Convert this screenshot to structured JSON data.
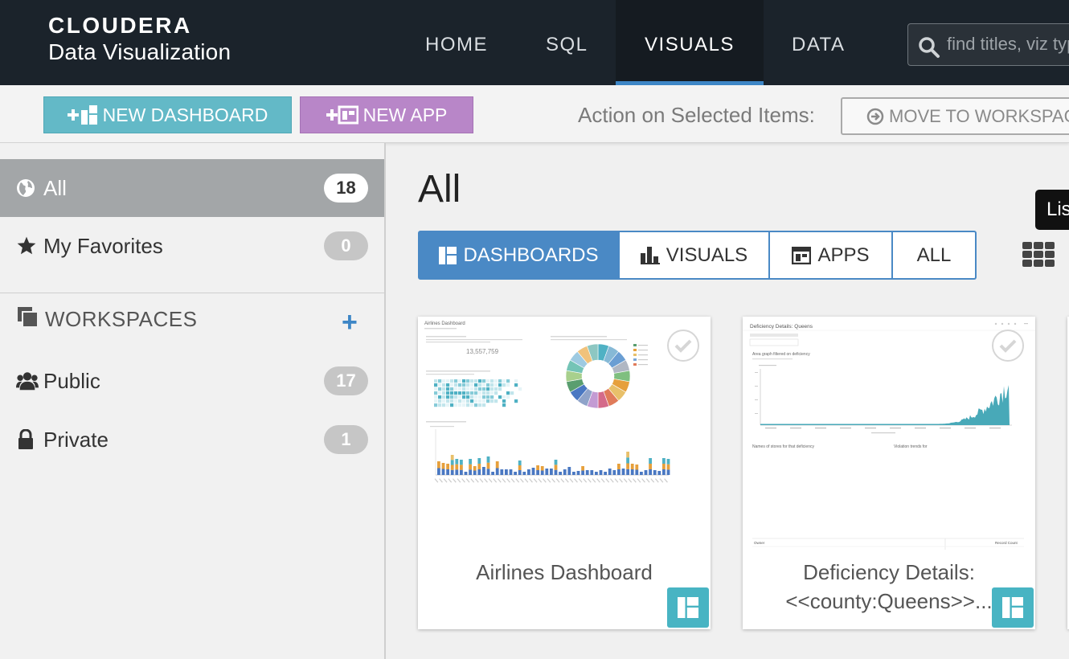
{
  "brand": {
    "logo_text": "CLOUDERA",
    "product": "Data Visualization"
  },
  "nav": {
    "home": "HOME",
    "sql": "SQL",
    "visuals": "VISUALS",
    "data": "DATA"
  },
  "search": {
    "placeholder": "find titles, viz types, tables..."
  },
  "actions": {
    "new_dashboard": "NEW DASHBOARD",
    "new_app": "NEW APP",
    "selected_label": "Action on Selected Items:",
    "move_to_workspace": "MOVE TO WORKSPACE"
  },
  "sidebar": {
    "all": {
      "label": "All",
      "count": "18"
    },
    "favorites": {
      "label": "My Favorites",
      "count": "0"
    },
    "workspaces_header": "WORKSPACES",
    "add_symbol": "+",
    "public": {
      "label": "Public",
      "count": "17"
    },
    "private": {
      "label": "Private",
      "count": "1"
    }
  },
  "main": {
    "title": "All",
    "tabs": {
      "dashboards": "DASHBOARDS",
      "visuals": "VISUALS",
      "apps": "APPS",
      "all": "ALL"
    },
    "tooltip": "List"
  },
  "cards": [
    {
      "title": "Airlines Dashboard",
      "thumb": {
        "heading": "Airlines Dashboard",
        "metric_value": "13,557,759"
      }
    },
    {
      "title": "Deficiency Details: <<county:Queens>>...",
      "thumb": {
        "heading": "Deficiency Details: Queens",
        "chart_title": "Area graph filtered on deficiency",
        "left_caption": "Names of stores for that deficiency",
        "right_caption": "Violation trends for",
        "table_col1": "Owner",
        "table_col2": "Record Count"
      }
    }
  ],
  "colors": {
    "topbar": "#1b232b",
    "accent_blue": "#4a89c5",
    "dashboard_teal": "#63b9c7",
    "app_purple": "#b886c8"
  }
}
